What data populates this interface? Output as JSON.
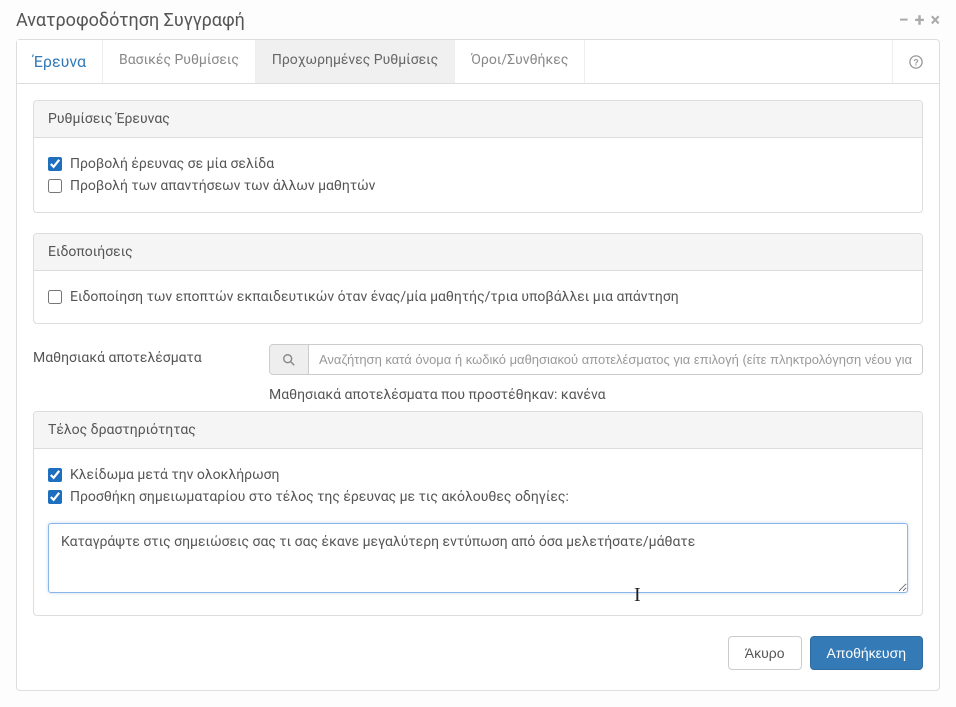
{
  "modal": {
    "title": "Ανατροφοδότηση Συγγραφή"
  },
  "tabs": {
    "research": "Έρευνα",
    "basic": "Βασικές Ρυθμίσεις",
    "advanced": "Προχωρημένες Ρυθμίσεις",
    "conditions": "Όροι/Συνθήκες"
  },
  "panels": {
    "survey_settings": {
      "title": "Ρυθμίσεις Έρευνας",
      "one_page": "Προβολή έρευνας σε μία σελίδα",
      "show_others": "Προβολή των απαντήσεων των άλλων μαθητών"
    },
    "notifications": {
      "title": "Ειδοποιήσεις",
      "notify_monitors": "Ειδοποίηση των εποπτών εκπαιδευτικών όταν ένας/μία μαθητής/τρια υποβάλλει μια απάντηση"
    },
    "outcomes": {
      "label": "Μαθησιακά αποτελέσματα",
      "placeholder": "Αναζήτηση κατά όνομα ή κωδικό μαθησιακού αποτελέσματος για επιλογή (είτε πληκτρολόγηση νέου για προσθήκη",
      "added": "Μαθησιακά αποτελέσματα που προστέθηκαν: κανένα"
    },
    "end_activity": {
      "title": "Τέλος δραστηριότητας",
      "lock_after": "Κλείδωμα μετά την ολοκλήρωση",
      "add_notebook": "Προσθήκη σημειωματαρίου στο τέλος της έρευνας με τις ακόλουθες οδηγίες:",
      "notebook_text": "Καταγράψτε στις σημειώσεις σας τι σας έκανε μεγαλύτερη εντύπωση από όσα μελετήσατε/μάθατε"
    }
  },
  "buttons": {
    "cancel": "Άκυρο",
    "save": "Αποθήκευση"
  }
}
